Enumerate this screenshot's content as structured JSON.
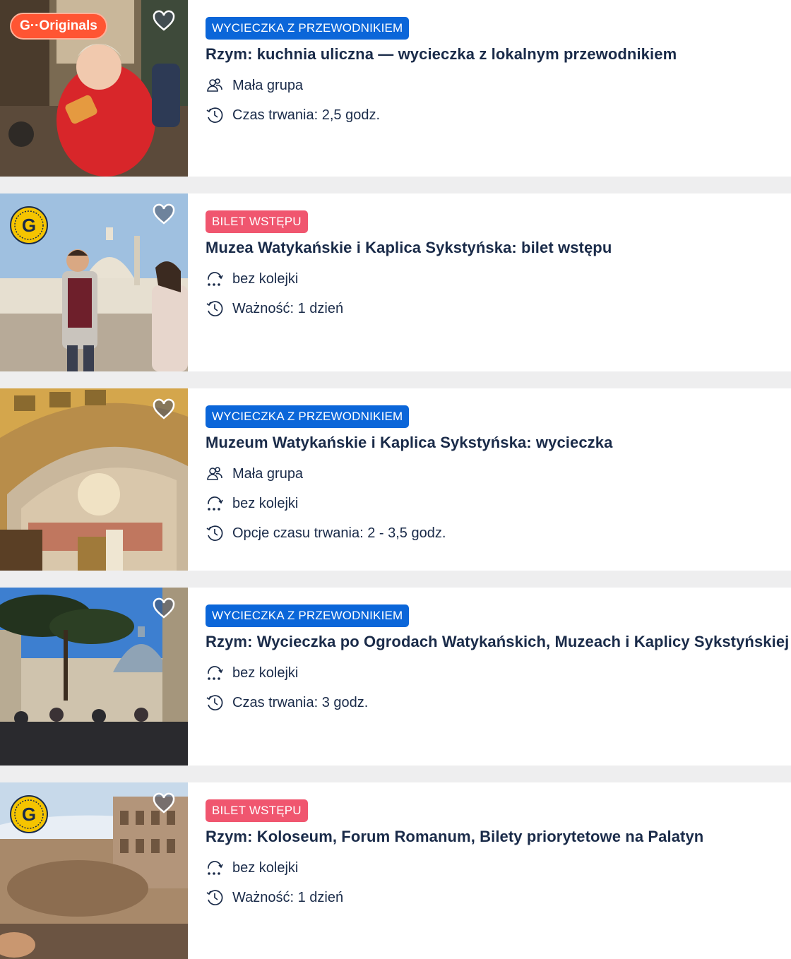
{
  "cards": [
    {
      "tag": "WYCIECZKA Z PRZEWODNIKIEM",
      "tag_type": "guided",
      "badge": "originals",
      "badge_text": "G··Originals",
      "title": "Rzym: kuchnia uliczna — wycieczka z lokalnym przewodnikiem",
      "features": [
        {
          "icon": "group-icon",
          "text": "Mała grupa"
        },
        {
          "icon": "clock-icon",
          "text": "Czas trwania: 2,5 godz."
        }
      ]
    },
    {
      "tag": "BILET WSTĘPU",
      "tag_type": "ticket",
      "badge": "g-coin",
      "title": "Muzea Watykańskie i Kaplica Sykstyńska: bilet wstępu",
      "features": [
        {
          "icon": "skip-line-icon",
          "text": "bez kolejki"
        },
        {
          "icon": "clock-icon",
          "text": "Ważność: 1 dzień"
        }
      ]
    },
    {
      "tag": "WYCIECZKA Z PRZEWODNIKIEM",
      "tag_type": "guided",
      "badge": "none",
      "title": "Muzeum Watykańskie i Kaplica Sykstyńska: wycieczka",
      "features": [
        {
          "icon": "group-icon",
          "text": "Mała grupa"
        },
        {
          "icon": "skip-line-icon",
          "text": "bez kolejki"
        },
        {
          "icon": "clock-icon",
          "text": "Opcje czasu trwania: 2 - 3,5 godz."
        }
      ]
    },
    {
      "tag": "WYCIECZKA Z PRZEWODNIKIEM",
      "tag_type": "guided",
      "badge": "none",
      "title": "Rzym: Wycieczka po Ogrodach Watykańskich, Muzeach i Kaplicy Sykstyńskiej",
      "features": [
        {
          "icon": "skip-line-icon",
          "text": "bez kolejki"
        },
        {
          "icon": "clock-icon",
          "text": "Czas trwania: 3 godz."
        }
      ]
    },
    {
      "tag": "BILET WSTĘPU",
      "tag_type": "ticket",
      "badge": "g-coin",
      "title": "Rzym: Koloseum, Forum Romanum, Bilety priorytetowe na Palatyn",
      "features": [
        {
          "icon": "skip-line-icon",
          "text": "bez kolejki"
        },
        {
          "icon": "clock-icon",
          "text": "Ważność: 1 dzień"
        }
      ]
    }
  ],
  "colors": {
    "guided_tag": "#0b66d9",
    "ticket_tag": "#f0566f",
    "originals_badge": "#ff5533",
    "text": "#1a2b49"
  }
}
